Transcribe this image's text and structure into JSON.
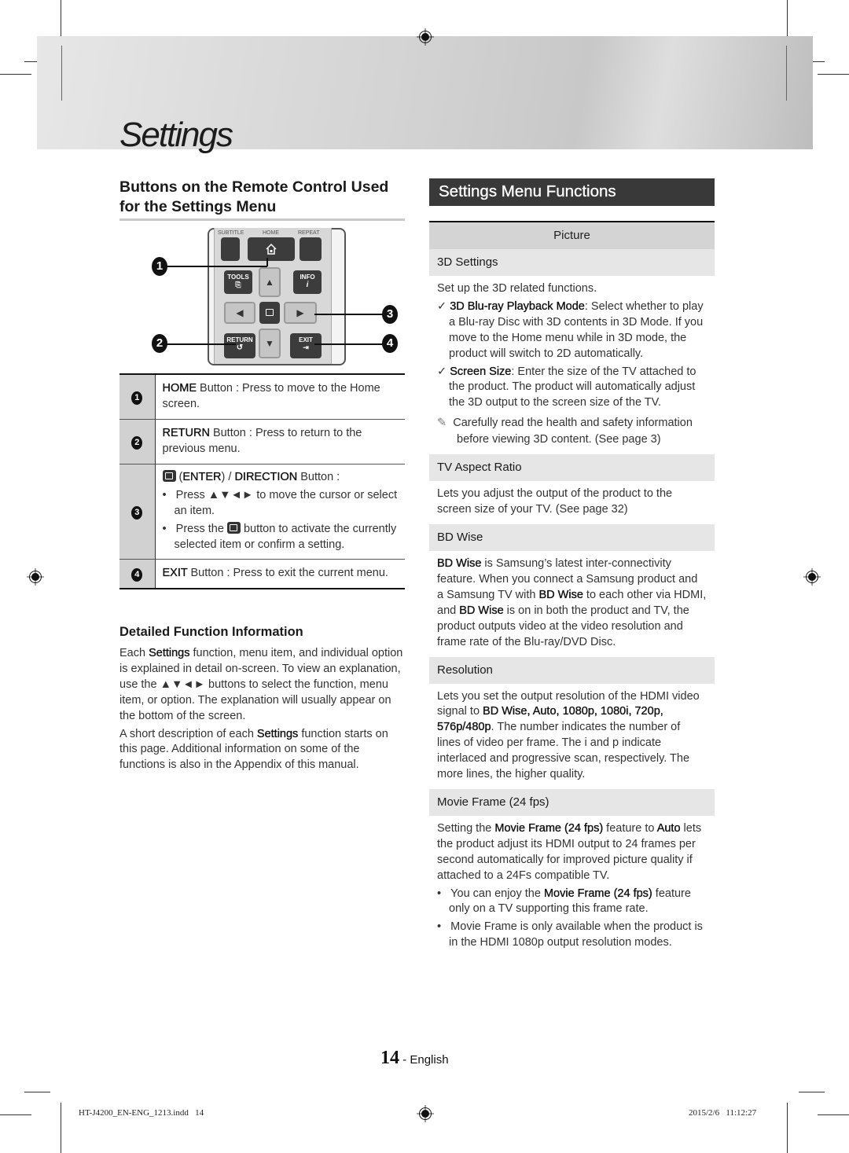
{
  "header": {
    "title": "Settings"
  },
  "left": {
    "heading": "Buttons on the Remote Control Used for the Settings Menu",
    "remote": {
      "labels": {
        "subtitle": "SUBTITLE",
        "home": "HOME",
        "repeat": "REPEAT",
        "tools": "TOOLS",
        "info": "INFO",
        "return": "RETURN",
        "exit": "EXIT"
      },
      "callouts": [
        "1",
        "2",
        "3",
        "4"
      ]
    },
    "table": [
      {
        "num": "1",
        "bold": "HOME",
        "text": " Button : Press to move to the Home screen."
      },
      {
        "num": "2",
        "bold": "RETURN",
        "text": " Button : Press to return to the previous menu."
      },
      {
        "num": "3",
        "line1_a": " (",
        "line1_b": "ENTER",
        "line1_c": ") / ",
        "line1_d": "DIRECTION",
        "line1_e": " Button :",
        "bullet1": "Press ▲▼◄► to move the cursor or select an item.",
        "bullet2_a": "Press the ",
        "bullet2_b": " button to activate the currently selected item or confirm a setting."
      },
      {
        "num": "4",
        "bold": "EXIT",
        "text": " Button : Press to exit the current menu."
      }
    ],
    "detail_heading": "Detailed Function Information",
    "para1_a": "Each ",
    "para1_b": "Settings",
    "para1_c": " function, menu item, and individual option is explained in detail on-screen. To view an explanation, use the ▲▼◄► buttons to select the function, menu item, or option. The explanation will usually appear on the bottom of the screen.",
    "para2_a": "A short description of each ",
    "para2_b": "Settings",
    "para2_c": " function starts on this page. Additional information on some of the functions is also in the Appendix of this manual."
  },
  "right": {
    "title": "Settings Menu Functions",
    "category": "Picture",
    "sections": {
      "s3d": {
        "head": "3D Settings",
        "intro": "Set up the 3D related functions.",
        "check1_bold": "3D Blu-ray Playback Mode",
        "check1_text": ": Select whether to play a Blu-ray Disc with 3D contents in 3D Mode. If you move to the Home menu while in 3D mode, the product will switch to 2D automatically.",
        "check2_bold": "Screen Size",
        "check2_text": ": Enter the size of the TV attached to the product. The product will automatically adjust the 3D output to the screen size of the TV.",
        "note": "Carefully read the health and safety information before viewing 3D content. (See page 3)"
      },
      "aspect": {
        "head": "TV Aspect Ratio",
        "body": "Lets you adjust the output of the product to the screen size of your TV. (See page 32)"
      },
      "bdwise": {
        "head": "BD Wise",
        "b1": "BD Wise",
        "t1": " is Samsung’s latest inter-connectivity feature. When you connect a Samsung product and a Samsung TV with ",
        "b2": "BD Wise",
        "t2": " to each other via HDMI, and ",
        "b3": "BD Wise",
        "t3": " is on in both the product and TV, the product outputs video at the video resolution and frame rate of the Blu-ray/DVD Disc."
      },
      "resolution": {
        "head": "Resolution",
        "t1": "Lets you set the output resolution of the HDMI video signal to ",
        "b1": "BD Wise, Auto, 1080p, 1080i, 720p, 576p/480p",
        "t2": ". The number indicates the number of lines of video per frame. The i and p indicate interlaced and progressive scan, respectively. The more lines, the higher quality."
      },
      "movie": {
        "head": "Movie Frame (24 fps)",
        "t1": "Setting the ",
        "b1": "Movie Frame (24 fps)",
        "t2": " feature to ",
        "b2": "Auto",
        "t3": " lets the product adjust its HDMI output to 24 frames per second automatically for improved picture quality if attached to a 24Fs compatible TV.",
        "bullet1_a": "You can enjoy the ",
        "bullet1_b": "Movie Frame (24 fps)",
        "bullet1_c": " feature only on a TV supporting this frame rate.",
        "bullet2": "Movie Frame is only available when the product is in the HDMI 1080p output resolution modes."
      }
    }
  },
  "footer": {
    "page_number": "14",
    "page_sep": " - ",
    "language": "English",
    "file": "HT-J4200_EN-ENG_1213.indd   14",
    "datetime": "2015/2/6   11:12:27"
  }
}
